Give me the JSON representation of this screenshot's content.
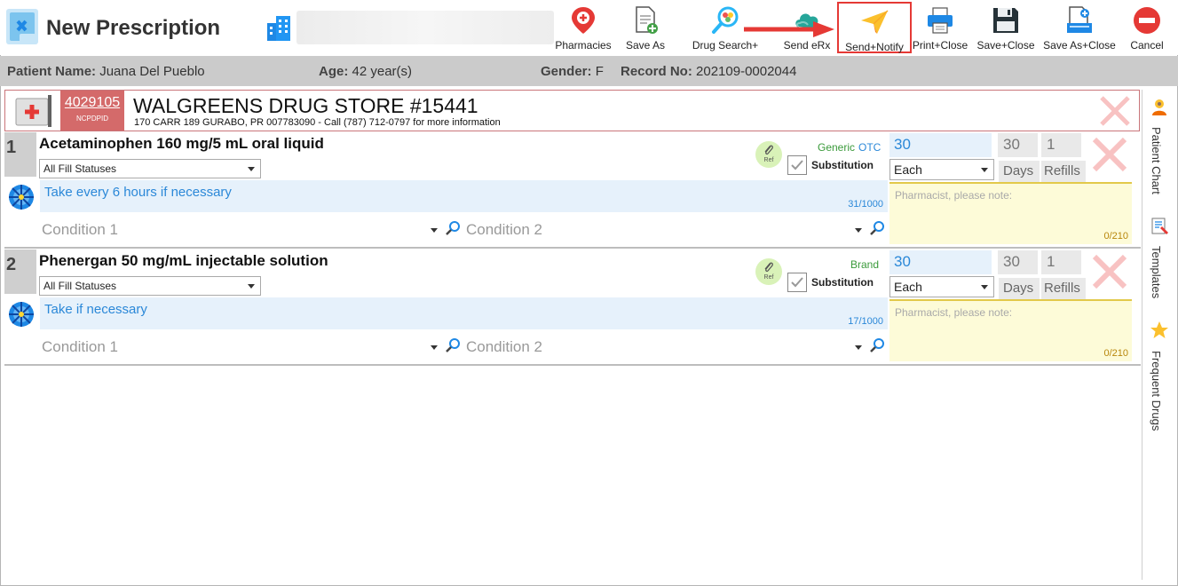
{
  "window": {
    "title": "New Prescription"
  },
  "toolbar": {
    "buttons": [
      {
        "label": "Pharmacies",
        "icon": "map-pin-icon"
      },
      {
        "label": "Save As",
        "icon": "save-as-document-icon"
      },
      {
        "label": "Drug Search+",
        "icon": "pill-search-icon"
      },
      {
        "label": "Send eRx",
        "icon": "cloud-send-icon"
      },
      {
        "label": "Send+Notify",
        "icon": "paper-plane-icon",
        "highlighted": true
      },
      {
        "label": "Print+Close",
        "icon": "printer-icon"
      },
      {
        "label": "Save+Close",
        "icon": "floppy-disk-icon"
      },
      {
        "label": "Save As+Close",
        "icon": "save-as-close-icon"
      },
      {
        "label": "Cancel",
        "icon": "cancel-icon"
      }
    ]
  },
  "patient": {
    "name_label": "Patient Name:",
    "name": "Juana Del Pueblo",
    "age_label": "Age:",
    "age": "42 year(s)",
    "gender_label": "Gender:",
    "gender": "F",
    "record_label": "Record No:",
    "record": "202109-0002044"
  },
  "pharmacy": {
    "ncpdp_id": "4029105",
    "ncpdp_label": "NCPDPID",
    "name": "WALGREENS DRUG STORE #15441",
    "address": "170 CARR 189 GURABO, PR 007783090 - Call (787) 712-0797 for more information"
  },
  "prescriptions": [
    {
      "number": "1",
      "drug": "Acetaminophen 160 mg/5 mL oral liquid",
      "fill_status": "All Fill Statuses",
      "sig": "Take every 6 hours if necessary",
      "sig_count": "31/1000",
      "condition1": "Condition 1",
      "condition2": "Condition 2",
      "ref_label": "Ref",
      "type_primary": "Generic",
      "type_secondary": "OTC",
      "substitution": "Substitution",
      "quantity": "30",
      "days_value": "30",
      "refills_value": "1",
      "unit": "Each",
      "days_label": "Days",
      "refills_label": "Refills",
      "note_placeholder": "Pharmacist, please note:",
      "note_count": "0/210"
    },
    {
      "number": "2",
      "drug": "Phenergan 50 mg/mL injectable solution",
      "fill_status": "All Fill Statuses",
      "sig": "Take if necessary",
      "sig_count": "17/1000",
      "condition1": "Condition 1",
      "condition2": "Condition 2",
      "ref_label": "Ref",
      "type_primary": "Brand",
      "type_secondary": "",
      "substitution": "Substitution",
      "quantity": "30",
      "days_value": "30",
      "refills_value": "1",
      "unit": "Each",
      "days_label": "Days",
      "refills_label": "Refills",
      "note_placeholder": "Pharmacist, please note:",
      "note_count": "0/210"
    }
  ],
  "side_panel": [
    {
      "label": "Patient Chart",
      "icon": "patient-chart-icon"
    },
    {
      "label": "Templates",
      "icon": "templates-icon"
    },
    {
      "label": "Frequent Drugs",
      "icon": "star-icon"
    }
  ],
  "colors": {
    "accent_blue": "#2b88d8",
    "pharmacy_red": "#d46a6a",
    "highlight_red": "#e53935",
    "generic_green": "#3a9a3a"
  }
}
